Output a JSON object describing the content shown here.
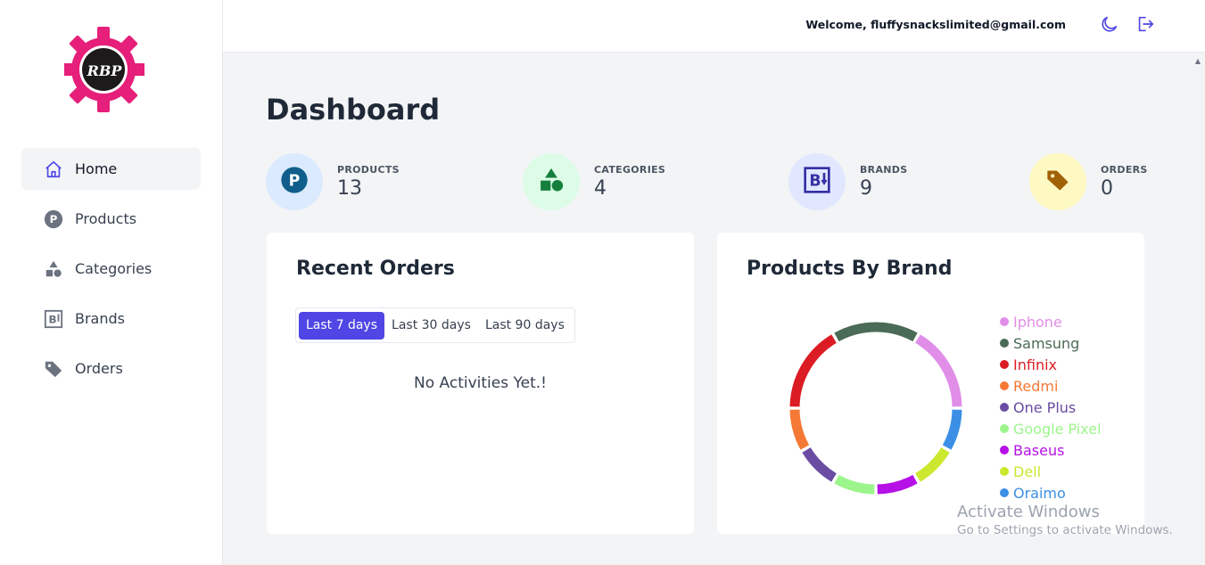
{
  "app": {
    "logo_text": "RBP"
  },
  "sidebar": {
    "items": [
      {
        "label": "Home",
        "icon": "home-icon",
        "active": true
      },
      {
        "label": "Products",
        "icon": "p-circle-icon"
      },
      {
        "label": "Categories",
        "icon": "shapes-icon"
      },
      {
        "label": "Brands",
        "icon": "brand-b-icon"
      },
      {
        "label": "Orders",
        "icon": "tag-icon"
      }
    ]
  },
  "header": {
    "welcome": "Welcome, fluffysnackslimited@gmail.com",
    "icons": [
      "moon-icon",
      "logout-icon"
    ]
  },
  "page": {
    "title": "Dashboard"
  },
  "stats": [
    {
      "label": "PRODUCTS",
      "value": "13",
      "icon": "p-circle-icon",
      "bg": "#dbeafe",
      "fg": "#0f5e8c"
    },
    {
      "label": "CATEGORIES",
      "value": "4",
      "icon": "shapes-icon",
      "bg": "#dcfce7",
      "fg": "#15803d"
    },
    {
      "label": "BRANDS",
      "value": "9",
      "icon": "brand-b-icon",
      "bg": "#e0e7ff",
      "fg": "#3730a3"
    },
    {
      "label": "ORDERS",
      "value": "0",
      "icon": "tag-icon",
      "bg": "#fef9c3",
      "fg": "#a16207"
    }
  ],
  "recent_orders": {
    "title": "Recent Orders",
    "tabs": [
      "Last 7 days",
      "Last 30 days",
      "Last 90 days"
    ],
    "active_tab": 0,
    "empty_text": "No Activities Yet.!"
  },
  "products_by_brand": {
    "title": "Products By Brand",
    "brands": [
      {
        "name": "Iphone",
        "color": "#e08ee8"
      },
      {
        "name": "Samsung",
        "color": "#4a6b55"
      },
      {
        "name": "Infinix",
        "color": "#dc1c24"
      },
      {
        "name": "Redmi",
        "color": "#f57835"
      },
      {
        "name": "One Plus",
        "color": "#6a4ca3"
      },
      {
        "name": "Google Pixel",
        "color": "#9cf58c"
      },
      {
        "name": "Baseus",
        "color": "#b510e6"
      },
      {
        "name": "Dell",
        "color": "#cbe82e"
      },
      {
        "name": "Oraimo",
        "color": "#3b8fe5"
      }
    ]
  },
  "chart_data": {
    "type": "pie",
    "title": "Products By Brand",
    "categories": [
      "Samsung",
      "Iphone",
      "Oraimo",
      "Dell",
      "Baseus",
      "Google Pixel",
      "One Plus",
      "Redmi",
      "Infinix"
    ],
    "values": [
      2,
      2,
      1,
      1,
      1,
      1,
      1,
      1,
      2
    ],
    "colors": [
      "#4a6b55",
      "#e08ee8",
      "#3b8fe5",
      "#cbe82e",
      "#b510e6",
      "#9cf58c",
      "#6a4ca3",
      "#f57835",
      "#dc1c24"
    ],
    "legend": "right"
  },
  "watermark": {
    "line1": "Activate Windows",
    "line2": "Go to Settings to activate Windows."
  }
}
